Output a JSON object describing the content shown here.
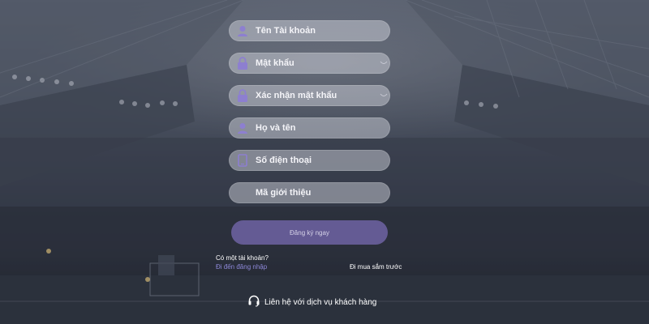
{
  "form": {
    "fields": [
      {
        "placeholder": "Tên Tài khoản",
        "icon": "user-icon"
      },
      {
        "placeholder": "Mật khẩu",
        "icon": "lock-icon",
        "toggle": "eye-closed-icon"
      },
      {
        "placeholder": "Xác nhận mật khẩu",
        "icon": "lock-icon",
        "toggle": "eye-closed-icon"
      },
      {
        "placeholder": "Họ và tên",
        "icon": "user-icon"
      },
      {
        "placeholder": "Số điện thoại",
        "icon": "phone-icon"
      },
      {
        "placeholder": "Mã giới thiệu",
        "icon": ""
      }
    ],
    "submit_label": "Đăng ký ngay"
  },
  "footer": {
    "have_account": "Có một tài khoản?",
    "login_link": "Đi đến đăng nhập",
    "guest_link": "Đi mua sắm trước",
    "support_label": "Liên hệ với dịch vụ khách hàng",
    "support_icon": "headset-icon"
  },
  "colors": {
    "accent": "#7d6eb9",
    "icon": "#8d7fd0",
    "link": "#8d88d8"
  }
}
